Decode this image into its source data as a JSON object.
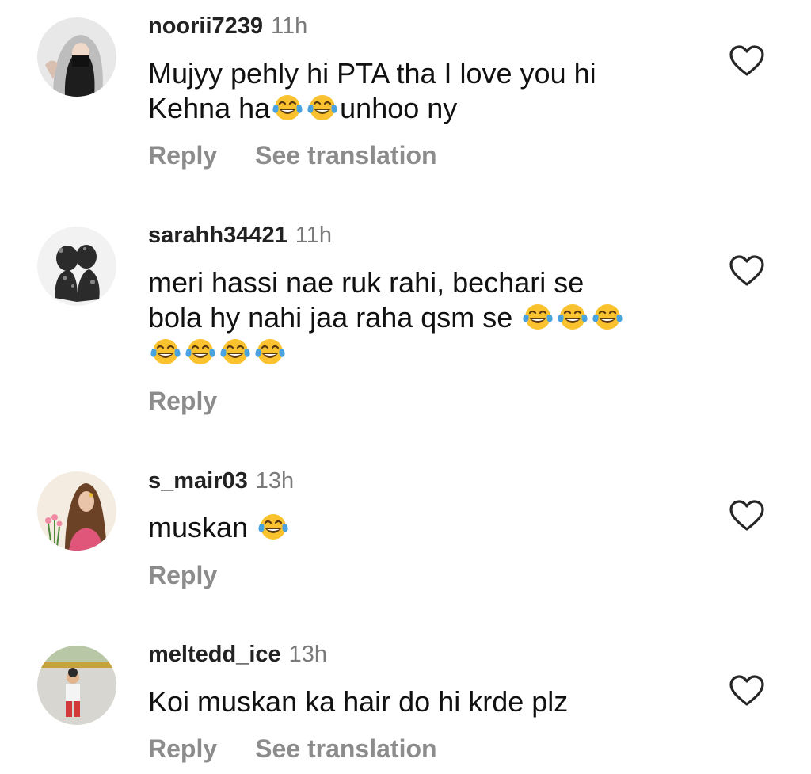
{
  "comments": [
    {
      "username": "noorii7239",
      "time": "11h",
      "lines": [
        "Mujyy pehly hi PTA tha I love you hi",
        "Kehna ha"
      ],
      "line2_suffix": "unhoo ny",
      "reply": "Reply",
      "see_translation": "See translation"
    },
    {
      "username": "sarahh34421",
      "time": "11h",
      "lines": [
        "meri hassi nae ruk rahi, bechari se",
        "bola hy nahi jaa raha qsm se"
      ],
      "reply": "Reply"
    },
    {
      "username": "s_mair03",
      "time": "13h",
      "lines": [
        "muskan"
      ],
      "reply": "Reply"
    },
    {
      "username": "meltedd_ice",
      "time": "13h",
      "lines": [
        "Koi muskan ka hair do hi krde plz"
      ],
      "reply": "Reply",
      "see_translation": "See translation"
    }
  ],
  "icons": {
    "like": "heart-outline-icon",
    "emoji": "face-with-tears-of-joy-emoji"
  },
  "colors": {
    "text": "#111111",
    "meta": "#7a7a7a",
    "action": "#8c8c8c",
    "emoji_face": "#f9c22e",
    "emoji_tears": "#4aa3df"
  }
}
